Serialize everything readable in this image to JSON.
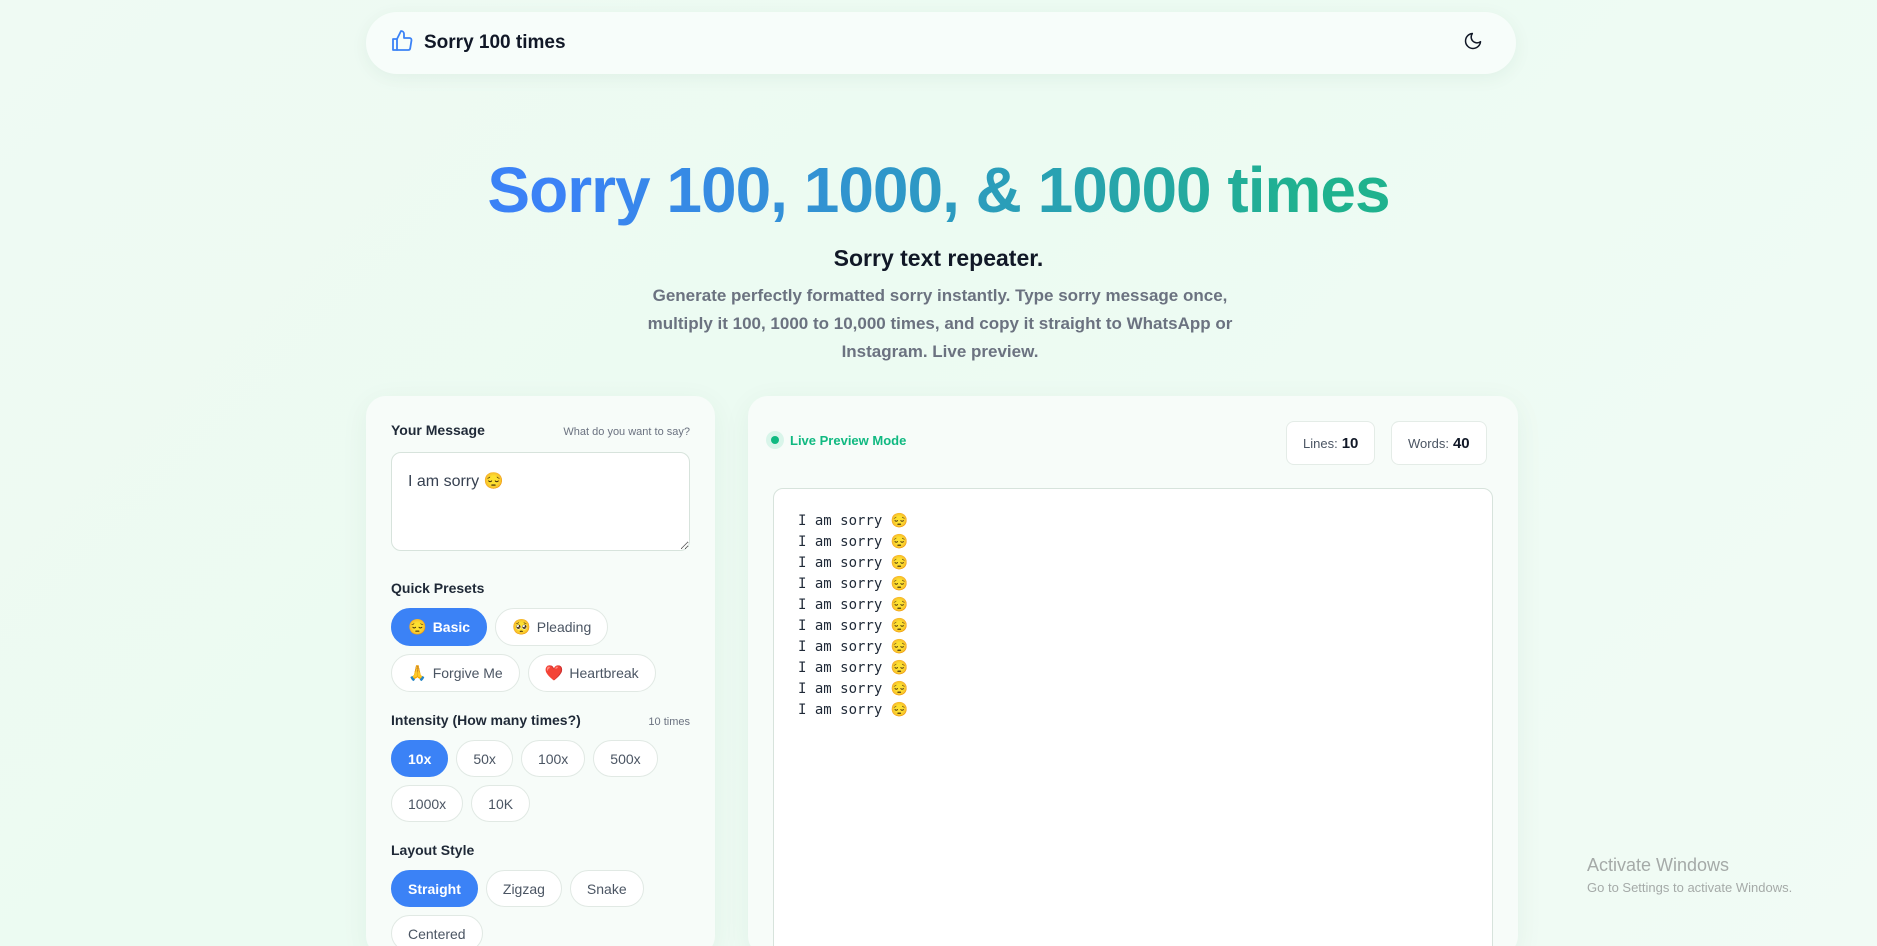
{
  "header": {
    "brand_name": "Sorry 100 times",
    "brand_icon": "thumbs-up-icon",
    "theme_icon": "moon-icon"
  },
  "hero": {
    "title": "Sorry 100, 1000, & 10000 times",
    "subtitle": "Sorry text repeater.",
    "description": "Generate perfectly formatted sorry instantly. Type sorry message once, multiply it 100, 1000 to 10,000 times, and copy it straight to WhatsApp or Instagram. Live preview."
  },
  "message": {
    "label": "Your Message",
    "hint": "What do you want to say?",
    "value": "I am sorry 😔"
  },
  "presets": {
    "label": "Quick Presets",
    "items": [
      {
        "emoji": "😔",
        "label": "Basic",
        "active": true
      },
      {
        "emoji": "🥺",
        "label": "Pleading",
        "active": false
      },
      {
        "emoji": "🙏",
        "label": "Forgive Me",
        "active": false
      },
      {
        "emoji": "❤️",
        "label": "Heartbreak",
        "active": false
      }
    ]
  },
  "intensity": {
    "label": "Intensity (How many times?)",
    "hint": "10 times",
    "options": [
      "10x",
      "50x",
      "100x",
      "500x",
      "1000x",
      "10K"
    ],
    "selected": "10x"
  },
  "layout_style": {
    "label": "Layout Style",
    "options": [
      "Straight",
      "Zigzag",
      "Snake",
      "Centered"
    ],
    "selected": "Straight"
  },
  "preview": {
    "mode_label": "Live Preview Mode",
    "lines_label": "Lines:",
    "lines_value": "10",
    "words_label": "Words:",
    "words_value": "40",
    "lines": [
      "I am sorry 😔",
      "I am sorry 😔",
      "I am sorry 😔",
      "I am sorry 😔",
      "I am sorry 😔",
      "I am sorry 😔",
      "I am sorry 😔",
      "I am sorry 😔",
      "I am sorry 😔",
      "I am sorry 😔"
    ]
  },
  "watermark": {
    "title": "Activate Windows",
    "subtitle": "Go to Settings to activate Windows."
  },
  "colors": {
    "accent": "#3b82f6",
    "green": "#10b981",
    "gradient_start": "#3b82f6",
    "gradient_end": "#1fb28e"
  }
}
